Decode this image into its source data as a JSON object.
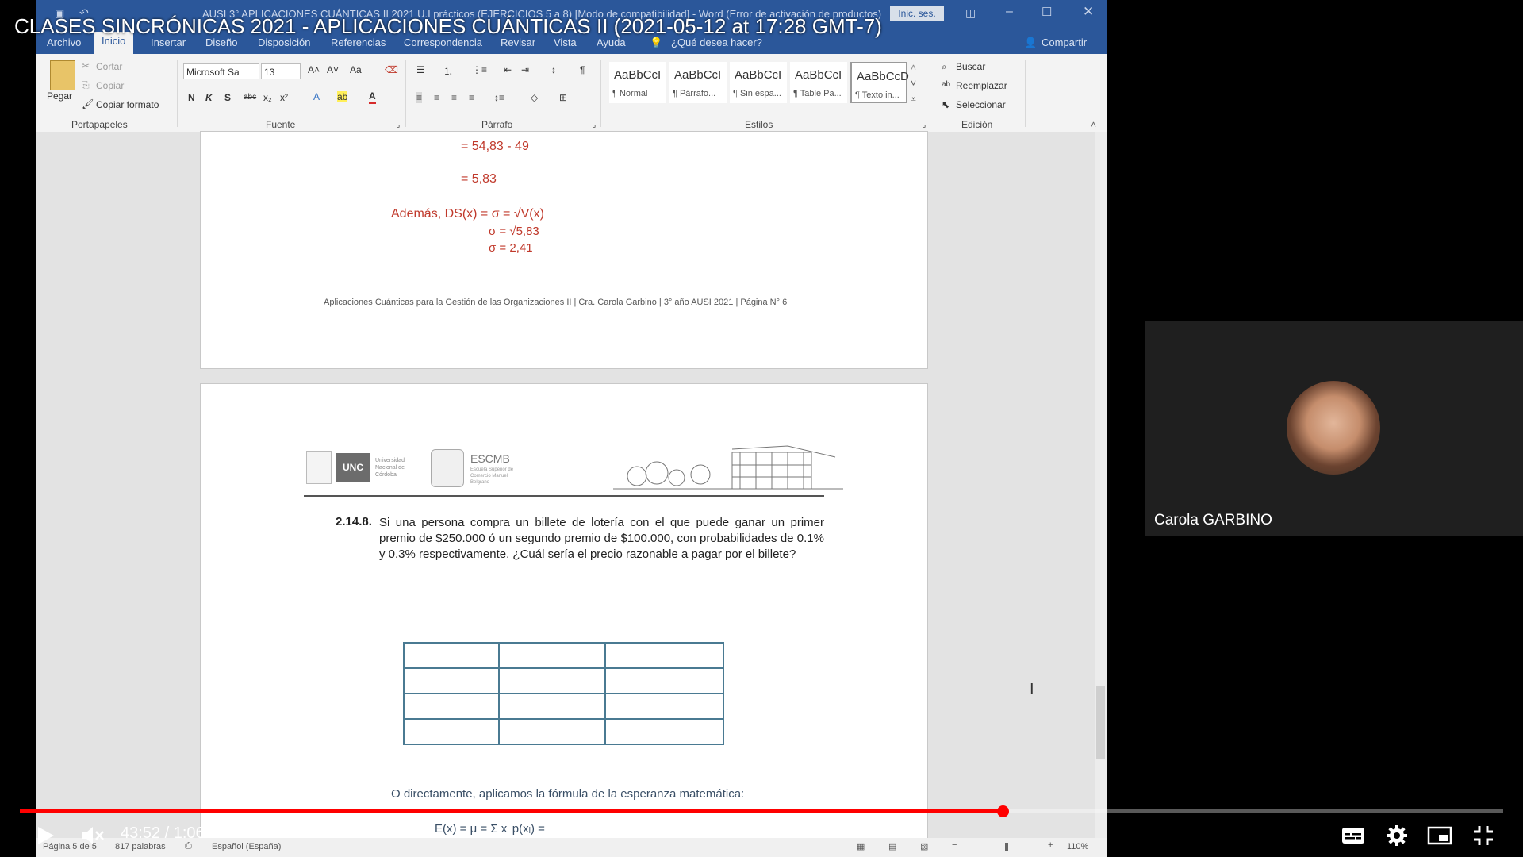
{
  "video": {
    "title": "CLASES SINCRÓNICAS 2021 - APLICACIONES CUÁNTICAS II (2021-05-12 at 17:28 GMT-7)",
    "time_current": "43:52",
    "time_total": "1:06:14",
    "time_sep": " / ",
    "progress_fraction": 0.6623,
    "participant_name": "Carola GARBINO",
    "accent_color": "#ff0000"
  },
  "word": {
    "window_title": "AUSI 3° APLICACIONES CUÁNTICAS II 2021 U.I prácticos (EJERCICIOS 5 a 8) [Modo de compatibilidad] - Word (Error de activación de productos)",
    "signin_label": "Inic. ses.",
    "tabs": [
      "Archivo",
      "Inicio",
      "Insertar",
      "Diseño",
      "Disposición",
      "Referencias",
      "Correspondencia",
      "Revisar",
      "Vista",
      "Ayuda"
    ],
    "tellme": "¿Qué desea hacer?",
    "share_label": "Compartir",
    "clipboard": {
      "paste": "Pegar",
      "cut": "Cortar",
      "copy": "Copiar",
      "format_painter": "Copiar formato",
      "group": "Portapapeles"
    },
    "font": {
      "name": "Microsoft Sa",
      "size": "13",
      "group": "Fuente",
      "case": "Aa"
    },
    "paragraph": {
      "group": "Párrafo"
    },
    "styles": {
      "group": "Estilos",
      "items": [
        {
          "sample": "AaBbCcI",
          "name": "¶ Normal"
        },
        {
          "sample": "AaBbCcI",
          "name": "¶ Párrafo..."
        },
        {
          "sample": "AaBbCcI",
          "name": "¶ Sin espa..."
        },
        {
          "sample": "AaBbCcI",
          "name": "¶ Table Pa..."
        },
        {
          "sample": "AaBbCcD",
          "name": "¶ Texto in..."
        }
      ]
    },
    "editing": {
      "find": "Buscar",
      "replace": "Reemplazar",
      "select": "Seleccionar",
      "group": "Edición"
    },
    "status": {
      "page": "Página 5 de 5",
      "words": "817 palabras",
      "language": "Español (España)",
      "zoom": "110%"
    }
  },
  "document": {
    "calc_line1": "= 54,83 - 49",
    "calc_line2": "= 5,83",
    "calc_line3": "Además, DS(x) = σ = √V(x)",
    "calc_line4": "σ =  √5,83",
    "calc_line5": "σ = 2,41",
    "footer": "Aplicaciones Cuánticas para la Gestión de las Organizaciones II | Cra. Carola Garbino | 3° año AUSI 2021 | Página N° 6",
    "logo_unc": "UNC",
    "logo_unc_sub": "Universidad Nacional de Córdoba",
    "logo_escmb": "ESCMB",
    "logo_escmb_sub": "Escuela Superior de Comercio Manuel Belgrano",
    "exercise_number": "2.14.8.",
    "exercise_text": "Si una persona compra un billete de lotería con el que puede ganar un primer premio de $250.000 ó un segundo premio de $100.000, con probabilidades de 0.1% y 0.3% respectivamente. ¿Cuál sería el precio razonable a pagar por el billete?",
    "formula_intro": "O directamente, aplicamos la fórmula de la esperanza matemática:",
    "formula": "E(x) = μ = Σ xᵢ p(xᵢ) ="
  }
}
